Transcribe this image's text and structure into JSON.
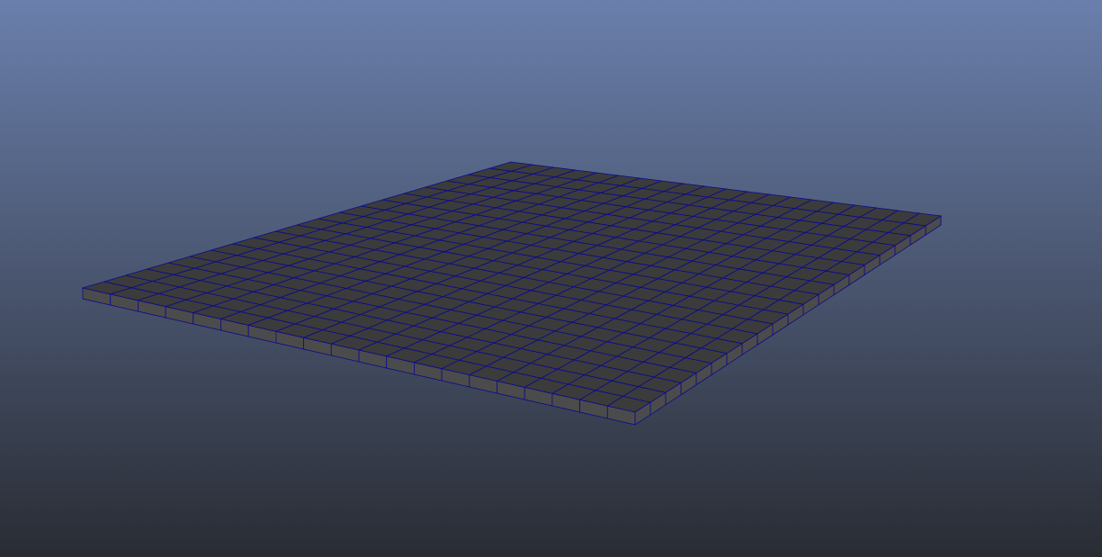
{
  "viewport": {
    "background_top_color": "#6a7fac",
    "background_bottom_color": "#292c33"
  },
  "mesh": {
    "name": "polygon plane",
    "subdivisions_width": 20,
    "subdivisions_height": 20,
    "top_face_color": "#3b3b3b",
    "side_face_color": "#4b4b4b",
    "wireframe_color": "#0a0a8c"
  }
}
